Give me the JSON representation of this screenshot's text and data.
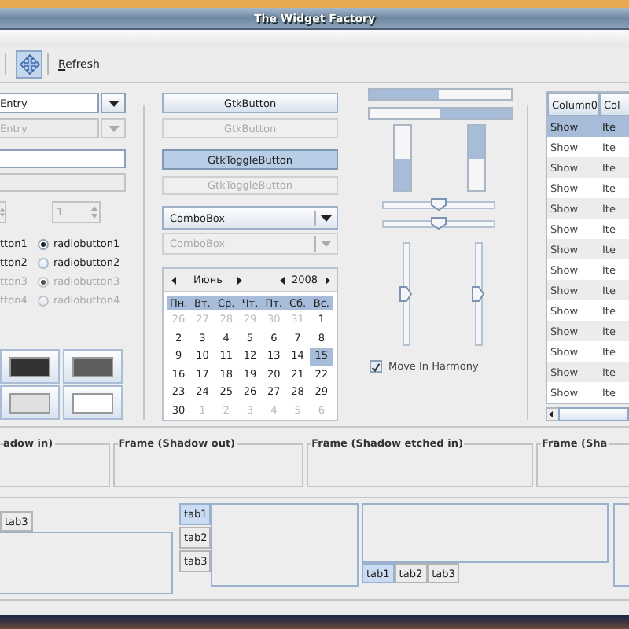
{
  "window": {
    "title": "The Widget Factory"
  },
  "toolbar": {
    "toggle_on": true,
    "refresh": "Refresh"
  },
  "entry_combos": [
    {
      "value": "Entry",
      "disabled": false
    },
    {
      "value": "Entry",
      "disabled": true
    }
  ],
  "text_fields": [
    {
      "disabled": false
    },
    {
      "disabled": true
    }
  ],
  "spin_buttons": [
    {
      "disabled": true
    },
    {
      "value": "1",
      "disabled": true
    }
  ],
  "check_radio": [
    {
      "check": "tton1",
      "radio": "radiobutton1",
      "selected": true,
      "disabled": false
    },
    {
      "check": "tton2",
      "radio": "radiobutton2",
      "selected": false,
      "disabled": false
    },
    {
      "check": "tton3",
      "radio": "radiobutton3",
      "selected": true,
      "disabled": true
    },
    {
      "check": "tton4",
      "radio": "radiobutton4",
      "selected": false,
      "disabled": true
    }
  ],
  "color_buttons": [
    {
      "color": "#333333"
    },
    {
      "color": "#5e5e5e"
    },
    {
      "color": "#e0e0e0"
    },
    {
      "color": "#ffffff"
    }
  ],
  "buttons": [
    {
      "label": "GtkButton",
      "on": false,
      "disabled": false
    },
    {
      "label": "GtkButton",
      "on": false,
      "disabled": true
    },
    {
      "label": "GtkToggleButton",
      "on": true,
      "disabled": false
    },
    {
      "label": "GtkToggleButton",
      "on": false,
      "disabled": true
    }
  ],
  "combos": [
    {
      "value": "ComboBox",
      "disabled": false
    },
    {
      "value": "ComboBox",
      "disabled": true
    }
  ],
  "calendar": {
    "month": "Июнь",
    "year": "2008",
    "weekdays": [
      "Пн.",
      "Вт.",
      "Ср.",
      "Чт.",
      "Пт.",
      "Сб.",
      "Вс."
    ],
    "days": [
      {
        "label": "26",
        "other_month": true,
        "selected": false
      },
      {
        "label": "27",
        "other_month": true,
        "selected": false
      },
      {
        "label": "28",
        "other_month": true,
        "selected": false
      },
      {
        "label": "29",
        "other_month": true,
        "selected": false
      },
      {
        "label": "30",
        "other_month": true,
        "selected": false
      },
      {
        "label": "31",
        "other_month": true,
        "selected": false
      },
      {
        "label": "1",
        "other_month": false,
        "selected": false
      },
      {
        "label": "2",
        "other_month": false,
        "selected": false
      },
      {
        "label": "3",
        "other_month": false,
        "selected": false
      },
      {
        "label": "4",
        "other_month": false,
        "selected": false
      },
      {
        "label": "5",
        "other_month": false,
        "selected": false
      },
      {
        "label": "6",
        "other_month": false,
        "selected": false
      },
      {
        "label": "7",
        "other_month": false,
        "selected": false
      },
      {
        "label": "8",
        "other_month": false,
        "selected": false
      },
      {
        "label": "9",
        "other_month": false,
        "selected": false
      },
      {
        "label": "10",
        "other_month": false,
        "selected": false
      },
      {
        "label": "11",
        "other_month": false,
        "selected": false
      },
      {
        "label": "12",
        "other_month": false,
        "selected": false
      },
      {
        "label": "13",
        "other_month": false,
        "selected": false
      },
      {
        "label": "14",
        "other_month": false,
        "selected": false
      },
      {
        "label": "15",
        "other_month": false,
        "selected": true
      },
      {
        "label": "16",
        "other_month": false,
        "selected": false
      },
      {
        "label": "17",
        "other_month": false,
        "selected": false
      },
      {
        "label": "18",
        "other_month": false,
        "selected": false
      },
      {
        "label": "19",
        "other_month": false,
        "selected": false
      },
      {
        "label": "20",
        "other_month": false,
        "selected": false
      },
      {
        "label": "21",
        "other_month": false,
        "selected": false
      },
      {
        "label": "22",
        "other_month": false,
        "selected": false
      },
      {
        "label": "23",
        "other_month": false,
        "selected": false
      },
      {
        "label": "24",
        "other_month": false,
        "selected": false
      },
      {
        "label": "25",
        "other_month": false,
        "selected": false
      },
      {
        "label": "26",
        "other_month": false,
        "selected": false
      },
      {
        "label": "27",
        "other_month": false,
        "selected": false
      },
      {
        "label": "28",
        "other_month": false,
        "selected": false
      },
      {
        "label": "29",
        "other_month": false,
        "selected": false
      },
      {
        "label": "30",
        "other_month": false,
        "selected": false
      },
      {
        "label": "1",
        "other_month": true,
        "selected": false
      },
      {
        "label": "2",
        "other_month": true,
        "selected": false
      },
      {
        "label": "3",
        "other_month": true,
        "selected": false
      },
      {
        "label": "4",
        "other_month": true,
        "selected": false
      },
      {
        "label": "5",
        "other_month": true,
        "selected": false
      },
      {
        "label": "6",
        "other_month": true,
        "selected": false
      }
    ]
  },
  "progress_bars": [
    {
      "kind": "left-to-right",
      "level": 0.49
    },
    {
      "kind": "right-to-left",
      "level": 0.5
    },
    {
      "kind": "bottom-to-top",
      "level": 0.5
    },
    {
      "kind": "top-to-bottom",
      "level": 0.5
    }
  ],
  "horizontal_scales": [
    {
      "level": 0.5
    },
    {
      "level": 0.5
    }
  ],
  "vertical_scales": [
    {
      "level": 0.5
    },
    {
      "level": 0.5
    }
  ],
  "harmony": {
    "label": "Move In Harmony",
    "checked": true
  },
  "tree": {
    "columns": [
      "Column0",
      "Col"
    ],
    "rows": [
      {
        "cells": [
          "Show",
          "Ite"
        ],
        "selected": true
      },
      {
        "cells": [
          "Show",
          "Ite"
        ],
        "selected": false
      },
      {
        "cells": [
          "Show",
          "Ite"
        ],
        "selected": false
      },
      {
        "cells": [
          "Show",
          "Ite"
        ],
        "selected": false
      },
      {
        "cells": [
          "Show",
          "Ite"
        ],
        "selected": false
      },
      {
        "cells": [
          "Show",
          "Ite"
        ],
        "selected": false
      },
      {
        "cells": [
          "Show",
          "Ite"
        ],
        "selected": false
      },
      {
        "cells": [
          "Show",
          "Ite"
        ],
        "selected": false
      },
      {
        "cells": [
          "Show",
          "Ite"
        ],
        "selected": false
      },
      {
        "cells": [
          "Show",
          "Ite"
        ],
        "selected": false
      },
      {
        "cells": [
          "Show",
          "Ite"
        ],
        "selected": false
      },
      {
        "cells": [
          "Show",
          "Ite"
        ],
        "selected": false
      },
      {
        "cells": [
          "Show",
          "Ite"
        ],
        "selected": false
      },
      {
        "cells": [
          "Show",
          "Ite"
        ],
        "selected": false
      }
    ]
  },
  "frames": [
    {
      "title": "adow in)"
    },
    {
      "title": "Frame (Shadow out)"
    },
    {
      "title": "Frame (Shadow etched in)"
    },
    {
      "title": "Frame (Sha"
    }
  ],
  "notebooks": [
    {
      "kind": "top",
      "tabs": [
        {
          "label": "tab3",
          "selected": false
        }
      ]
    },
    {
      "kind": "left",
      "tabs": [
        {
          "label": "tab1",
          "selected": true
        },
        {
          "label": "tab2",
          "selected": false
        },
        {
          "label": "tab3",
          "selected": false
        }
      ]
    },
    {
      "kind": "bottom",
      "tabs": [
        {
          "label": "tab1",
          "selected": true
        },
        {
          "label": "tab2",
          "selected": false
        },
        {
          "label": "tab3",
          "selected": false
        }
      ]
    },
    {
      "kind": "right"
    }
  ]
}
